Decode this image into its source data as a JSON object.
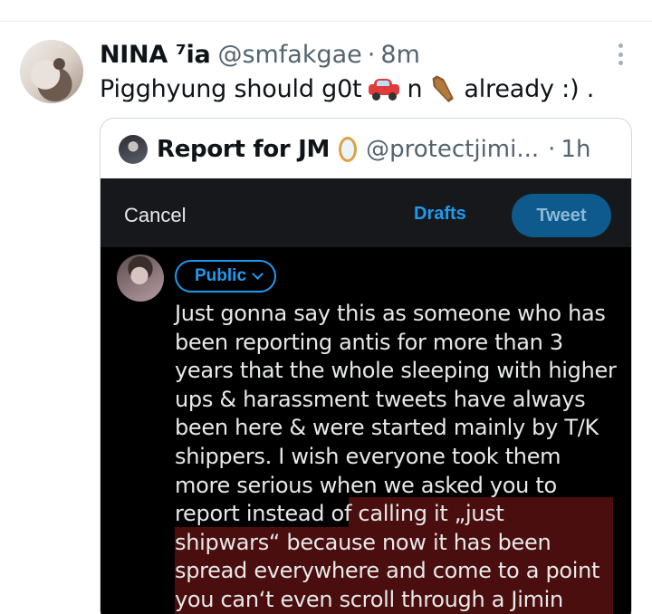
{
  "tweet": {
    "display_name": "NINA ⁷ia",
    "handle": "@smfakgae",
    "separator": "·",
    "time": "8m",
    "text_part1": "Pigghyung should g0t",
    "text_part2": "n",
    "text_part3": "already :) .",
    "emoji_1": "car-emoji",
    "emoji_2": "coffin-emoji"
  },
  "quote": {
    "name": "Report for JM",
    "handle": "@protectjimi...",
    "separator": "·",
    "time": "1h",
    "name_emoji": "mirror-emoji"
  },
  "composer": {
    "cancel_label": "Cancel",
    "drafts_label": "Drafts",
    "tweet_label": "Tweet",
    "audience_label": "Public",
    "lines": [
      "Just gonna say this as someone who has",
      "been reporting antis for more than 3",
      "years that the whole sleeping with higher",
      "ups & harassment tweets have always",
      "been here & were started mainly by T/K",
      "shippers. I wish everyone took them",
      "more serious when we asked you to",
      "report instead of calling it „just",
      "shipwars“ because now it has been",
      "spread everywhere and come to a point",
      "you can‘t even scroll through a Jimin"
    ]
  },
  "colors": {
    "accent": "#1d9bf0",
    "highlight": "#4a0e0e",
    "muted": "#536471"
  }
}
